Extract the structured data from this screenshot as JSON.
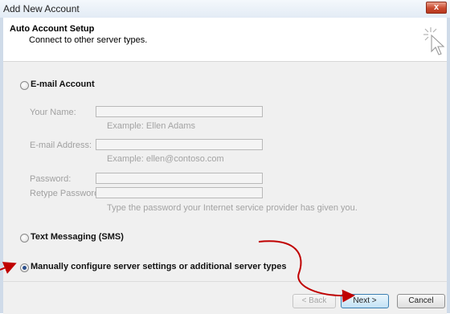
{
  "window": {
    "title": "Add New Account",
    "close_glyph": "x"
  },
  "header": {
    "title": "Auto Account Setup",
    "subtitle": "Connect to other server types.",
    "icon": "pointer-sparkle-icon"
  },
  "email_option": {
    "label": "E-mail Account",
    "selected": false,
    "fields": {
      "your_name": {
        "label": "Your Name:",
        "value": "",
        "hint": "Example: Ellen Adams"
      },
      "email_address": {
        "label": "E-mail Address:",
        "value": "",
        "hint": "Example: ellen@contoso.com"
      },
      "password": {
        "label": "Password:",
        "value": ""
      },
      "retype_password": {
        "label": "Retype Password:",
        "value": "",
        "hint": "Type the password your Internet service provider has given you."
      }
    }
  },
  "sms_option": {
    "label": "Text Messaging (SMS)",
    "selected": false
  },
  "manual_option": {
    "label": "Manually configure server settings or additional server types",
    "selected": true
  },
  "buttons": {
    "back": "< Back",
    "next": "Next >",
    "cancel": "Cancel"
  },
  "colors": {
    "annotation_arrow": "#c00000",
    "selected_radio": "#2b4f8c"
  }
}
